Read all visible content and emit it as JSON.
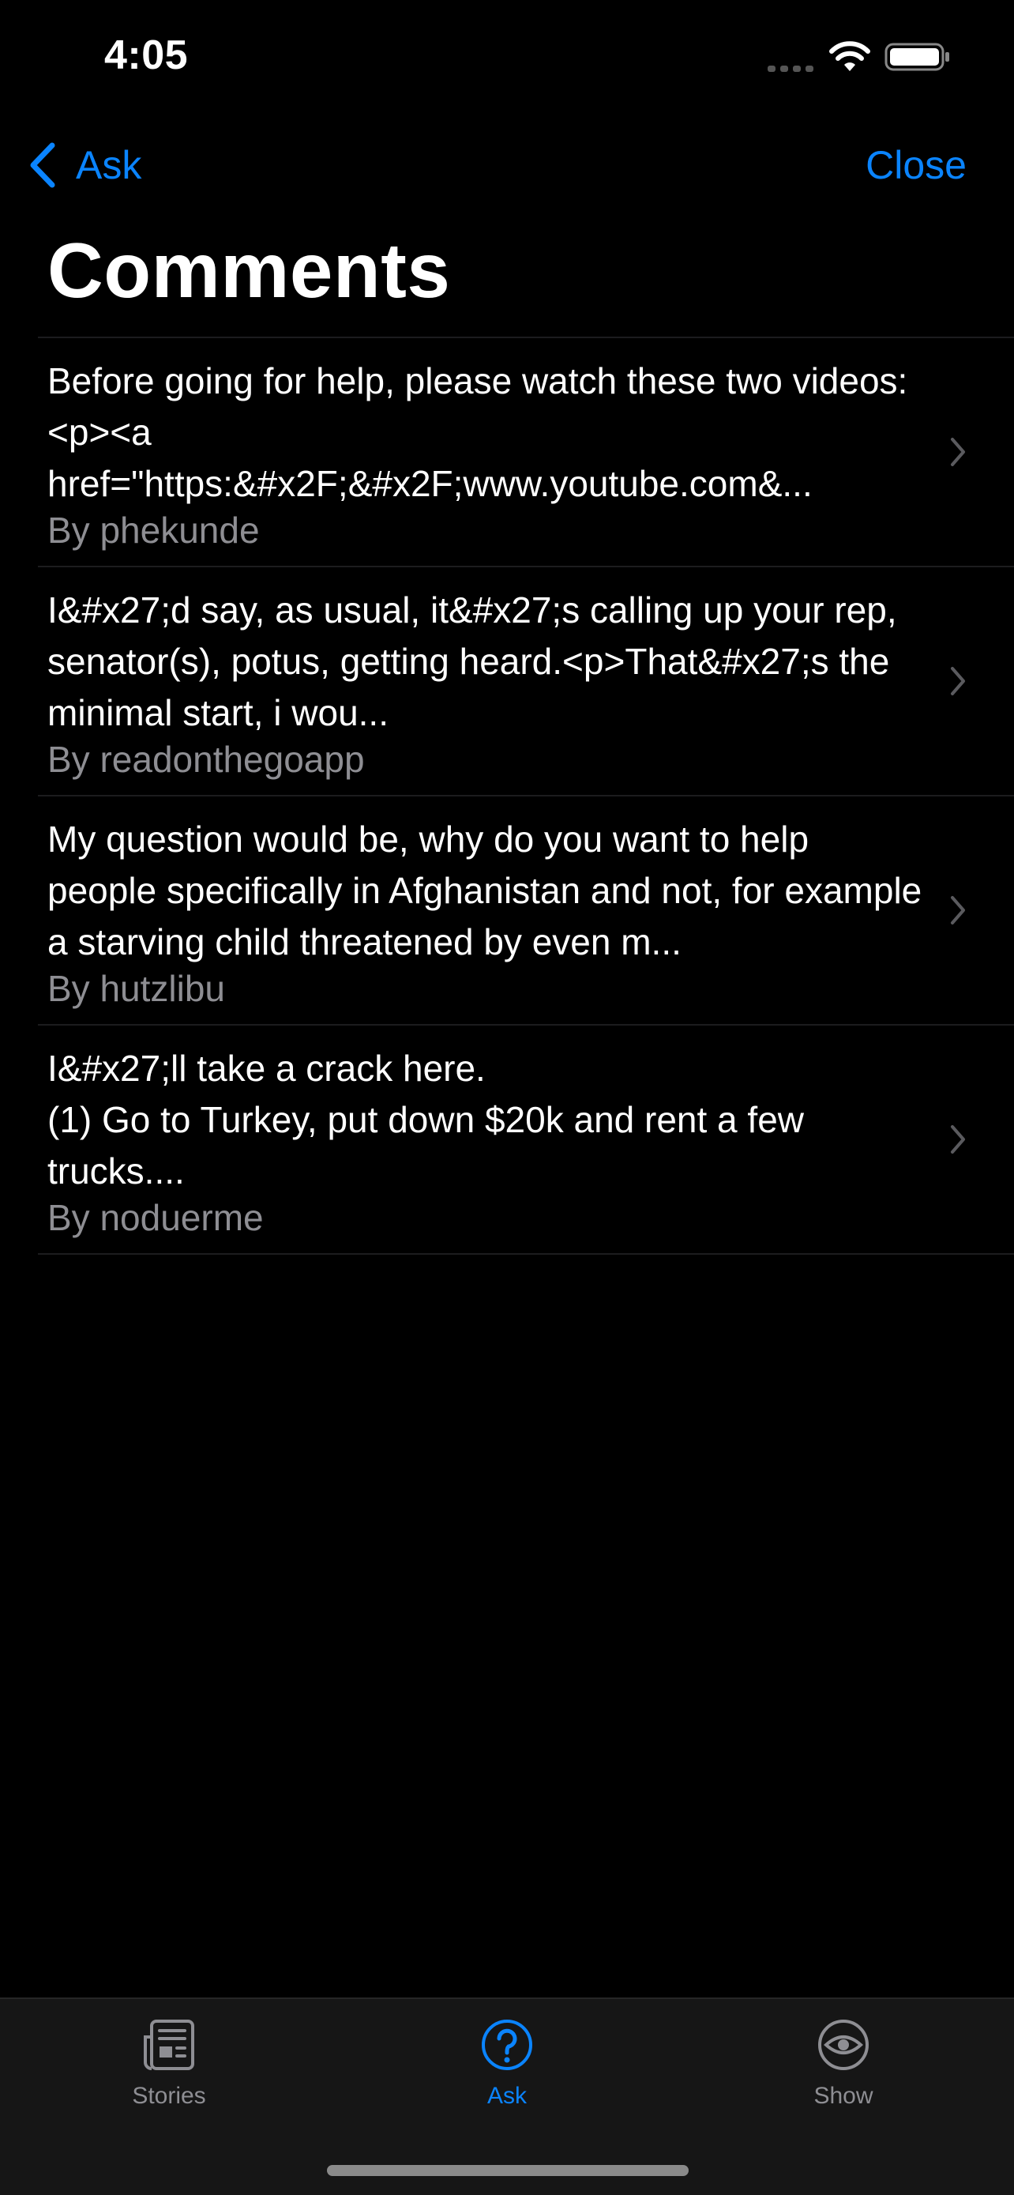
{
  "status_bar": {
    "time": "4:05",
    "icons": [
      "cellular-signal-icon",
      "wifi-icon",
      "battery-icon"
    ]
  },
  "nav": {
    "back_label": "Ask",
    "close_label": "Close",
    "back_icon": "chevron-left-icon",
    "accent_color": "#0a84ff"
  },
  "page": {
    "title": "Comments"
  },
  "comments": [
    {
      "text": "Before going for help, please watch these two videos:<p><a href=\"https:&#x2F;&#x2F;www.youtube.com&...",
      "author": "By phekunde"
    },
    {
      "text": "I&#x27;d say, as usual, it&#x27;s calling up your rep, senator(s), potus, getting heard.<p>That&#x27;s the minimal start, i wou...",
      "author": "By readonthegoapp"
    },
    {
      "text": "My question would be, why do you want to help people specifically in Afghanistan and not, for example a starving child threatened by even m...",
      "author": "By hutzlibu"
    },
    {
      "text": "I&#x27;ll take a crack here.\n(1) Go to Turkey, put down $20k and rent a few trucks....",
      "author": "By noduerme"
    }
  ],
  "tab_bar": {
    "tabs": [
      {
        "label": "Stories",
        "icon": "newspaper-icon",
        "active": false
      },
      {
        "label": "Ask",
        "icon": "question-circle-icon",
        "active": true
      },
      {
        "label": "Show",
        "icon": "eye-circle-icon",
        "active": false
      }
    ]
  },
  "colors": {
    "background": "#000000",
    "secondary_text": "#8e8e93",
    "separator": "#1c1c1e",
    "tab_bar_bg": "#161616"
  }
}
